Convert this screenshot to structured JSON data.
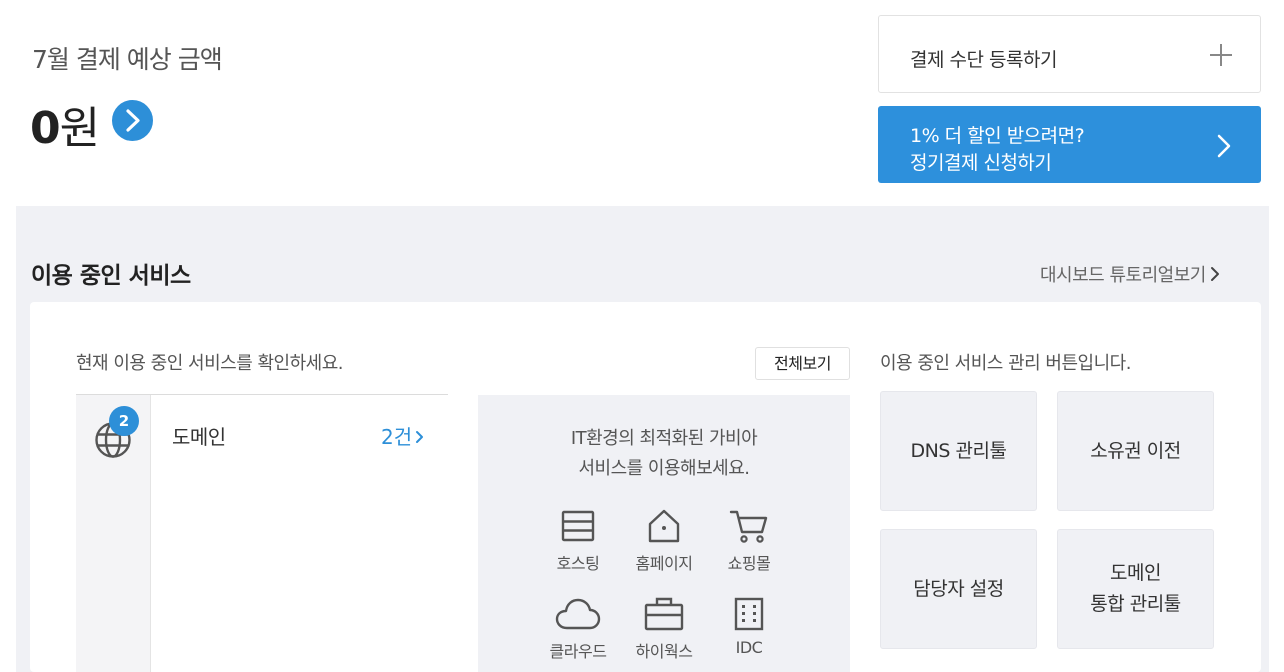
{
  "summary": {
    "month_title": "7월 결제 예상 금액",
    "amount_number": "0",
    "amount_unit": "원"
  },
  "payment": {
    "register_label": "결제 수단 등록하기",
    "discount_line1": "1% 더 할인 받으려면?",
    "discount_line2": "정기결제 신청하기"
  },
  "services": {
    "title": "이용 중인 서비스",
    "tutorial_link": "대시보드 튜토리얼보기",
    "description": "현재 이용 중인 서비스를 확인하세요.",
    "view_all": "전체보기",
    "items": [
      {
        "name": "도메인",
        "badge": "2",
        "count": "2건",
        "icon": "globe-icon"
      }
    ],
    "promo": {
      "line1": "IT환경의 최적화된 가비아",
      "line2": "서비스를 이용해보세요.",
      "items": [
        {
          "label": "호스팅",
          "icon": "hosting-icon"
        },
        {
          "label": "홈페이지",
          "icon": "homepage-icon"
        },
        {
          "label": "쇼핑몰",
          "icon": "cart-icon"
        },
        {
          "label": "클라우드",
          "icon": "cloud-icon"
        },
        {
          "label": "하이웍스",
          "icon": "briefcase-icon"
        },
        {
          "label": "IDC",
          "icon": "building-icon"
        }
      ]
    }
  },
  "management": {
    "description": "이용 중인 서비스 관리 버튼입니다.",
    "buttons": [
      {
        "line1": "DNS 관리툴",
        "line2": ""
      },
      {
        "line1": "소유권 이전",
        "line2": ""
      },
      {
        "line1": "담당자 설정",
        "line2": ""
      },
      {
        "line1": "도메인",
        "line2": "통합 관리툴"
      }
    ]
  },
  "colors": {
    "accent": "#2d8fd8",
    "section_bg": "#f0f1f5",
    "text_dark": "#222222"
  }
}
